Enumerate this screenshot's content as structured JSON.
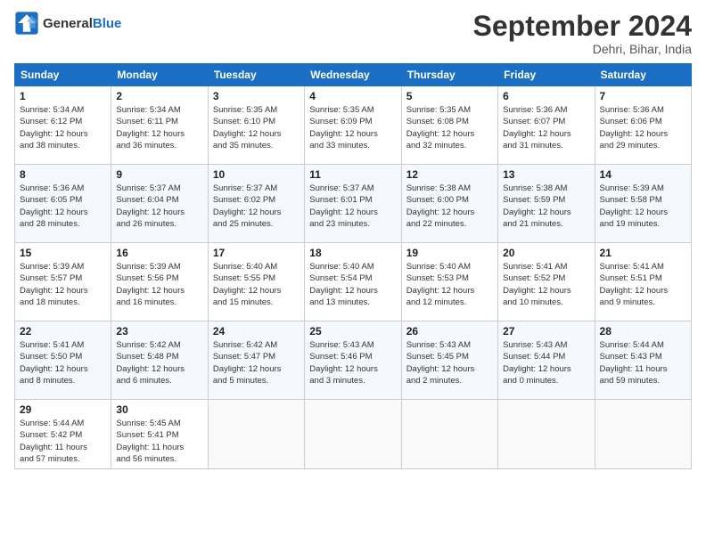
{
  "logo": {
    "line1": "General",
    "line2": "Blue"
  },
  "title": "September 2024",
  "location": "Dehri, Bihar, India",
  "days_of_week": [
    "Sunday",
    "Monday",
    "Tuesday",
    "Wednesday",
    "Thursday",
    "Friday",
    "Saturday"
  ],
  "weeks": [
    [
      {
        "num": "1",
        "info": "Sunrise: 5:34 AM\nSunset: 6:12 PM\nDaylight: 12 hours\nand 38 minutes."
      },
      {
        "num": "2",
        "info": "Sunrise: 5:34 AM\nSunset: 6:11 PM\nDaylight: 12 hours\nand 36 minutes."
      },
      {
        "num": "3",
        "info": "Sunrise: 5:35 AM\nSunset: 6:10 PM\nDaylight: 12 hours\nand 35 minutes."
      },
      {
        "num": "4",
        "info": "Sunrise: 5:35 AM\nSunset: 6:09 PM\nDaylight: 12 hours\nand 33 minutes."
      },
      {
        "num": "5",
        "info": "Sunrise: 5:35 AM\nSunset: 6:08 PM\nDaylight: 12 hours\nand 32 minutes."
      },
      {
        "num": "6",
        "info": "Sunrise: 5:36 AM\nSunset: 6:07 PM\nDaylight: 12 hours\nand 31 minutes."
      },
      {
        "num": "7",
        "info": "Sunrise: 5:36 AM\nSunset: 6:06 PM\nDaylight: 12 hours\nand 29 minutes."
      }
    ],
    [
      {
        "num": "8",
        "info": "Sunrise: 5:36 AM\nSunset: 6:05 PM\nDaylight: 12 hours\nand 28 minutes."
      },
      {
        "num": "9",
        "info": "Sunrise: 5:37 AM\nSunset: 6:04 PM\nDaylight: 12 hours\nand 26 minutes."
      },
      {
        "num": "10",
        "info": "Sunrise: 5:37 AM\nSunset: 6:02 PM\nDaylight: 12 hours\nand 25 minutes."
      },
      {
        "num": "11",
        "info": "Sunrise: 5:37 AM\nSunset: 6:01 PM\nDaylight: 12 hours\nand 23 minutes."
      },
      {
        "num": "12",
        "info": "Sunrise: 5:38 AM\nSunset: 6:00 PM\nDaylight: 12 hours\nand 22 minutes."
      },
      {
        "num": "13",
        "info": "Sunrise: 5:38 AM\nSunset: 5:59 PM\nDaylight: 12 hours\nand 21 minutes."
      },
      {
        "num": "14",
        "info": "Sunrise: 5:39 AM\nSunset: 5:58 PM\nDaylight: 12 hours\nand 19 minutes."
      }
    ],
    [
      {
        "num": "15",
        "info": "Sunrise: 5:39 AM\nSunset: 5:57 PM\nDaylight: 12 hours\nand 18 minutes."
      },
      {
        "num": "16",
        "info": "Sunrise: 5:39 AM\nSunset: 5:56 PM\nDaylight: 12 hours\nand 16 minutes."
      },
      {
        "num": "17",
        "info": "Sunrise: 5:40 AM\nSunset: 5:55 PM\nDaylight: 12 hours\nand 15 minutes."
      },
      {
        "num": "18",
        "info": "Sunrise: 5:40 AM\nSunset: 5:54 PM\nDaylight: 12 hours\nand 13 minutes."
      },
      {
        "num": "19",
        "info": "Sunrise: 5:40 AM\nSunset: 5:53 PM\nDaylight: 12 hours\nand 12 minutes."
      },
      {
        "num": "20",
        "info": "Sunrise: 5:41 AM\nSunset: 5:52 PM\nDaylight: 12 hours\nand 10 minutes."
      },
      {
        "num": "21",
        "info": "Sunrise: 5:41 AM\nSunset: 5:51 PM\nDaylight: 12 hours\nand 9 minutes."
      }
    ],
    [
      {
        "num": "22",
        "info": "Sunrise: 5:41 AM\nSunset: 5:50 PM\nDaylight: 12 hours\nand 8 minutes."
      },
      {
        "num": "23",
        "info": "Sunrise: 5:42 AM\nSunset: 5:48 PM\nDaylight: 12 hours\nand 6 minutes."
      },
      {
        "num": "24",
        "info": "Sunrise: 5:42 AM\nSunset: 5:47 PM\nDaylight: 12 hours\nand 5 minutes."
      },
      {
        "num": "25",
        "info": "Sunrise: 5:43 AM\nSunset: 5:46 PM\nDaylight: 12 hours\nand 3 minutes."
      },
      {
        "num": "26",
        "info": "Sunrise: 5:43 AM\nSunset: 5:45 PM\nDaylight: 12 hours\nand 2 minutes."
      },
      {
        "num": "27",
        "info": "Sunrise: 5:43 AM\nSunset: 5:44 PM\nDaylight: 12 hours\nand 0 minutes."
      },
      {
        "num": "28",
        "info": "Sunrise: 5:44 AM\nSunset: 5:43 PM\nDaylight: 11 hours\nand 59 minutes."
      }
    ],
    [
      {
        "num": "29",
        "info": "Sunrise: 5:44 AM\nSunset: 5:42 PM\nDaylight: 11 hours\nand 57 minutes."
      },
      {
        "num": "30",
        "info": "Sunrise: 5:45 AM\nSunset: 5:41 PM\nDaylight: 11 hours\nand 56 minutes."
      },
      {
        "num": "",
        "info": ""
      },
      {
        "num": "",
        "info": ""
      },
      {
        "num": "",
        "info": ""
      },
      {
        "num": "",
        "info": ""
      },
      {
        "num": "",
        "info": ""
      }
    ]
  ]
}
